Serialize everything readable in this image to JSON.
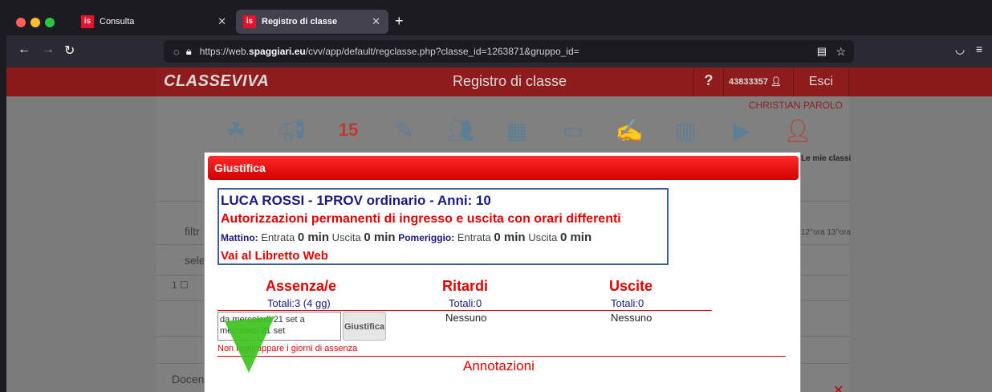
{
  "browser": {
    "tabs": [
      {
        "label": "Consulta",
        "favicon": "is"
      },
      {
        "label": "Registro di classe",
        "favicon": "is"
      }
    ],
    "url_prefix": "https://web.",
    "url_domain": "spaggiari.eu",
    "url_path": "/cvv/app/default/regclasse.php?classe_id=1263871&gruppo_id="
  },
  "app": {
    "logo": "CLASSEVIVA",
    "title": "Registro di classe",
    "help": "?",
    "user_code": "43833357",
    "exit_label": "Esci",
    "teacher": "CHRISTIAN PAROLO",
    "my_classes": "Le mie classi",
    "side_labels": {
      "filter": "filtr",
      "select": "sele",
      "row_num": "1",
      "docente": "Docen"
    },
    "ora_cols": "12°ora  13°ora"
  },
  "modal": {
    "title": "Giustifica",
    "student": "LUCA ROSSI - 1PROV ordinario - Anni: 10",
    "authorization": "Autorizzazioni permanenti di ingresso e uscita con orari differenti",
    "morning_label": "Mattino:",
    "afternoon_label": "Pomeriggio:",
    "entry_label": "Entrata",
    "exit_label": "Uscita",
    "morning_entry": "0 min",
    "morning_exit": "0 min",
    "afternoon_entry": "0 min",
    "afternoon_exit": "0 min",
    "libretto_link": "Vai al Libretto Web",
    "columns": [
      {
        "title": "Assenza/e",
        "total": "Totali:3 (4 gg)"
      },
      {
        "title": "Ritardi",
        "total": "Totali:0",
        "value": "Nessuno"
      },
      {
        "title": "Uscite",
        "total": "Totali:0",
        "value": "Nessuno"
      }
    ],
    "absence_period": "da mercoledì 21 set a mercoledì 21 set",
    "justify_button": "Giustifica",
    "no_group": "Non raggruppare i giorni di assenza",
    "annotations": "Annotazioni"
  }
}
